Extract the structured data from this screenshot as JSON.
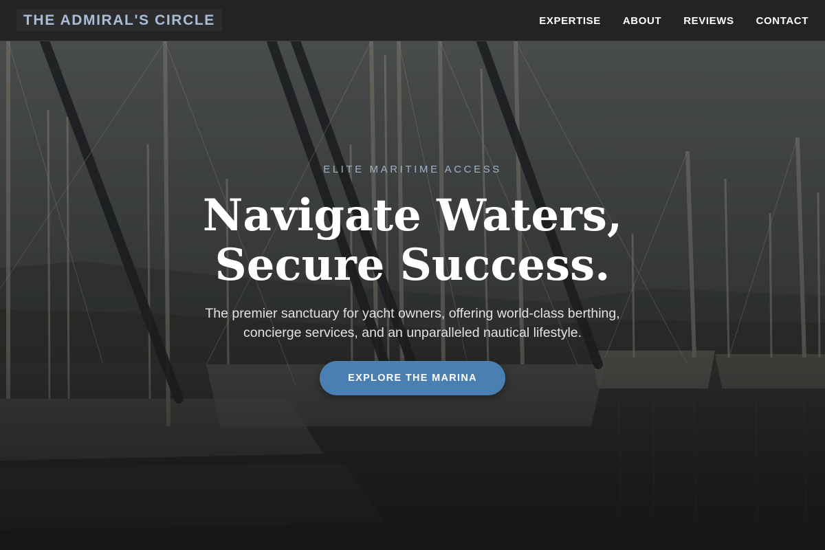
{
  "brand": {
    "name": "THE ADMIRAL'S CIRCLE"
  },
  "nav": {
    "items": [
      {
        "label": "EXPERTISE"
      },
      {
        "label": "ABOUT"
      },
      {
        "label": "REVIEWS"
      },
      {
        "label": "CONTACT"
      }
    ]
  },
  "hero": {
    "eyebrow": "ELITE MARITIME ACCESS",
    "headline_line1": "Navigate Waters,",
    "headline_line2": "Secure Success.",
    "subtext": "The premier sanctuary for yacht owners, offering world-class berthing, concierge services, and an unparalleled nautical lifestyle.",
    "cta_label": "EXPLORE THE MARINA",
    "background_image": "marina-sailboats-photo"
  },
  "colors": {
    "accent": "#4a7fb4",
    "brand_text": "#a9bdd8",
    "nav_bg": "#232323",
    "eyebrow_text": "#9fb2cc"
  }
}
